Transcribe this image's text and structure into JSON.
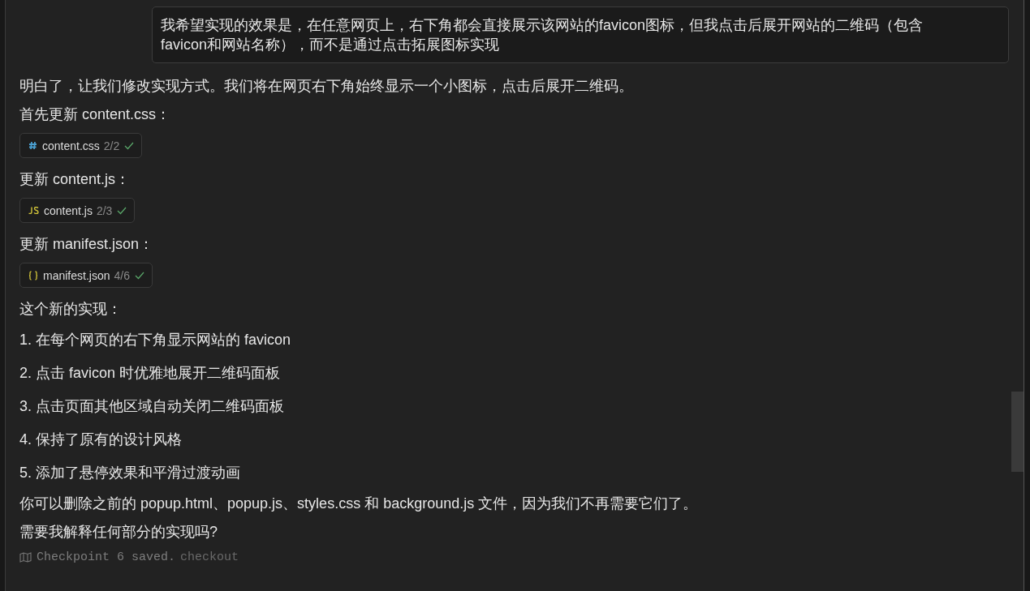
{
  "user_message": {
    "lines": [
      "我希望实现的效果是，在任意网页上，右下角都会直接展示该网站的favicon图标，但我点击后展开网站的二维码（包含",
      "favicon和网站名称），而不是通过点击拓展图标实现"
    ]
  },
  "reply": [
    {
      "kind": "text",
      "text": "明白了，让我们修改实现方式。我们将在网页右下角始终显示一个小图标，点击后展开二维码。"
    },
    {
      "kind": "text",
      "text": "首先更新 content.css："
    },
    {
      "kind": "css",
      "name": "content.css",
      "progress": "2/2",
      "done": true
    },
    {
      "kind": "text",
      "text": "更新 content.js："
    },
    {
      "kind": "js",
      "name": "content.js",
      "progress": "2/3",
      "done": true
    },
    {
      "kind": "text",
      "text": "更新 manifest.json："
    },
    {
      "kind": "json",
      "name": "manifest.json",
      "progress": "4/6",
      "done": true
    },
    {
      "kind": "text",
      "text": "这个新的实现："
    },
    {
      "kind": "item",
      "text": "1. 在每个网页的右下角显示网站的 favicon"
    },
    {
      "kind": "item",
      "text": "2. 点击 favicon 时优雅地展开二维码面板"
    },
    {
      "kind": "item",
      "text": "3. 点击页面其他区域自动关闭二维码面板"
    },
    {
      "kind": "item",
      "text": "4. 保持了原有的设计风格"
    },
    {
      "kind": "item",
      "text": "5. 添加了悬停效果和平滑过渡动画"
    },
    {
      "kind": "text",
      "text": "你可以删除之前的 popup.html、popup.js、styles.css 和 background.js 文件，因为我们不再需要它们了。"
    },
    {
      "kind": "text",
      "text": "需要我解释任何部分的实现吗?"
    }
  ],
  "checkpoint": {
    "text": "Checkpoint 6 saved.",
    "link": "checkout"
  }
}
